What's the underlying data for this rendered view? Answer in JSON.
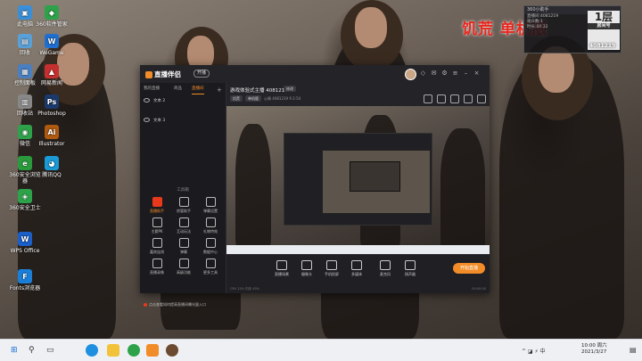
{
  "desktop": {
    "icons": [
      {
        "label": "此电脑",
        "color": "#3a8fd8",
        "glyph": "▣"
      },
      {
        "label": "360软件管家",
        "color": "#2ea24a",
        "glyph": "◆"
      },
      {
        "label": "回收",
        "color": "#5aa0d8",
        "glyph": "▤"
      },
      {
        "label": "WeGame",
        "color": "#1f6fd0",
        "glyph": "W"
      },
      {
        "label": "控制面板",
        "color": "#4a7fc0",
        "glyph": "▦"
      },
      {
        "label": "网易新闻",
        "color": "#c43030",
        "glyph": "▲"
      },
      {
        "label": "回收站",
        "color": "#888888",
        "glyph": "▥"
      },
      {
        "label": "Photoshop",
        "color": "#1b3a6d",
        "glyph": "Ps"
      },
      {
        "label": "微信",
        "color": "#2ea24a",
        "glyph": "◉"
      },
      {
        "label": "Illustrator",
        "color": "#b05a10",
        "glyph": "Ai"
      },
      {
        "label": "360安全浏览器",
        "color": "#2a9a3c",
        "glyph": "e"
      },
      {
        "label": "腾讯QQ",
        "color": "#1a9ad6",
        "glyph": "◕"
      },
      {
        "label": "360安全卫士",
        "color": "#2ea24a",
        "glyph": "◈"
      },
      {
        "label": "WPS Office",
        "color": "#1b5fc8",
        "glyph": "W"
      },
      {
        "label": "Fonts浏览器",
        "color": "#1b7fd8",
        "glyph": "F"
      }
    ]
  },
  "overlay": {
    "title": "饥荒 单机版",
    "mini_header": "360小助手",
    "mini_lines": [
      "直播间:4081219",
      "观众数:1",
      "时长:00:32"
    ],
    "room_main": "1层",
    "room_sub": "房间号",
    "room_number": "4081219"
  },
  "app": {
    "logo": "直播伴侣",
    "vip": "开播",
    "side_tabs": [
      "我的直播",
      "商品",
      "直播间"
    ],
    "scenes": [
      "文本 2",
      "文本 3"
    ],
    "tools_title": "工具箱",
    "tools": [
      "直播助手",
      "房管助手",
      "弹幕设置",
      "主题PK",
      "互动玩法",
      "礼物特效",
      "嘉宾连线",
      "弹幕",
      "数据中心",
      "直播录像",
      "高级功能",
      "更多工具"
    ],
    "notice": "点击查看如何提高直播间曝光量入口",
    "room_title": "游戏体验式主播 4081219",
    "edit_label": "修改",
    "meta_tags": [
      "饥荒",
      "单机版"
    ],
    "meta_text": "心情 4081219   9  2:54",
    "bottom_buttons": [
      "直播场景",
      "摄像头",
      "手机投屏",
      "多媒体",
      "麦克风",
      "扬声器"
    ],
    "live_button": "开始直播",
    "status_left": "CPU 12%  内存 45%",
    "status_right": "00:00:00"
  },
  "taskbar": {
    "clock_time": "10:00 周六",
    "clock_date": "2021/3/27",
    "tray_text": "^ ◪ ⚡ 中"
  }
}
